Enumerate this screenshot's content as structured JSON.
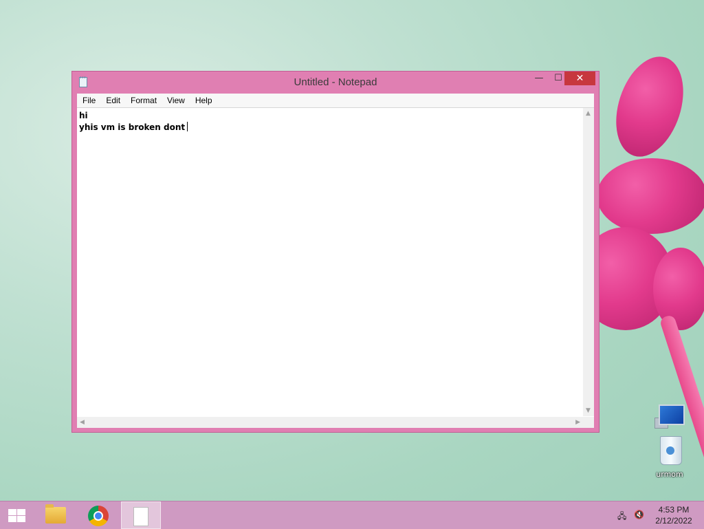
{
  "window": {
    "title": "Untitled - Notepad",
    "minimize_glyph": "—",
    "maximize_glyph": "☐",
    "close_glyph": "✕"
  },
  "menu": [
    "File",
    "Edit",
    "Format",
    "View",
    "Help"
  ],
  "editor": {
    "text": "hi\nyhis vm is broken dont"
  },
  "desktop_icons": [
    {
      "name": "pc-icon",
      "label": ""
    },
    {
      "name": "recycle-bin-icon",
      "label": "urmom"
    }
  ],
  "taskbar": {
    "pinned": [
      "windows-start-icon",
      "file-explorer-icon",
      "chrome-icon",
      "notepad-icon"
    ],
    "active": "notepad"
  },
  "clock": {
    "time": "4:53 PM",
    "date": "2/12/2022"
  },
  "colors": {
    "accent": "#e07fb2",
    "close": "#c7373e",
    "taskbar": "#cf9ac2"
  }
}
